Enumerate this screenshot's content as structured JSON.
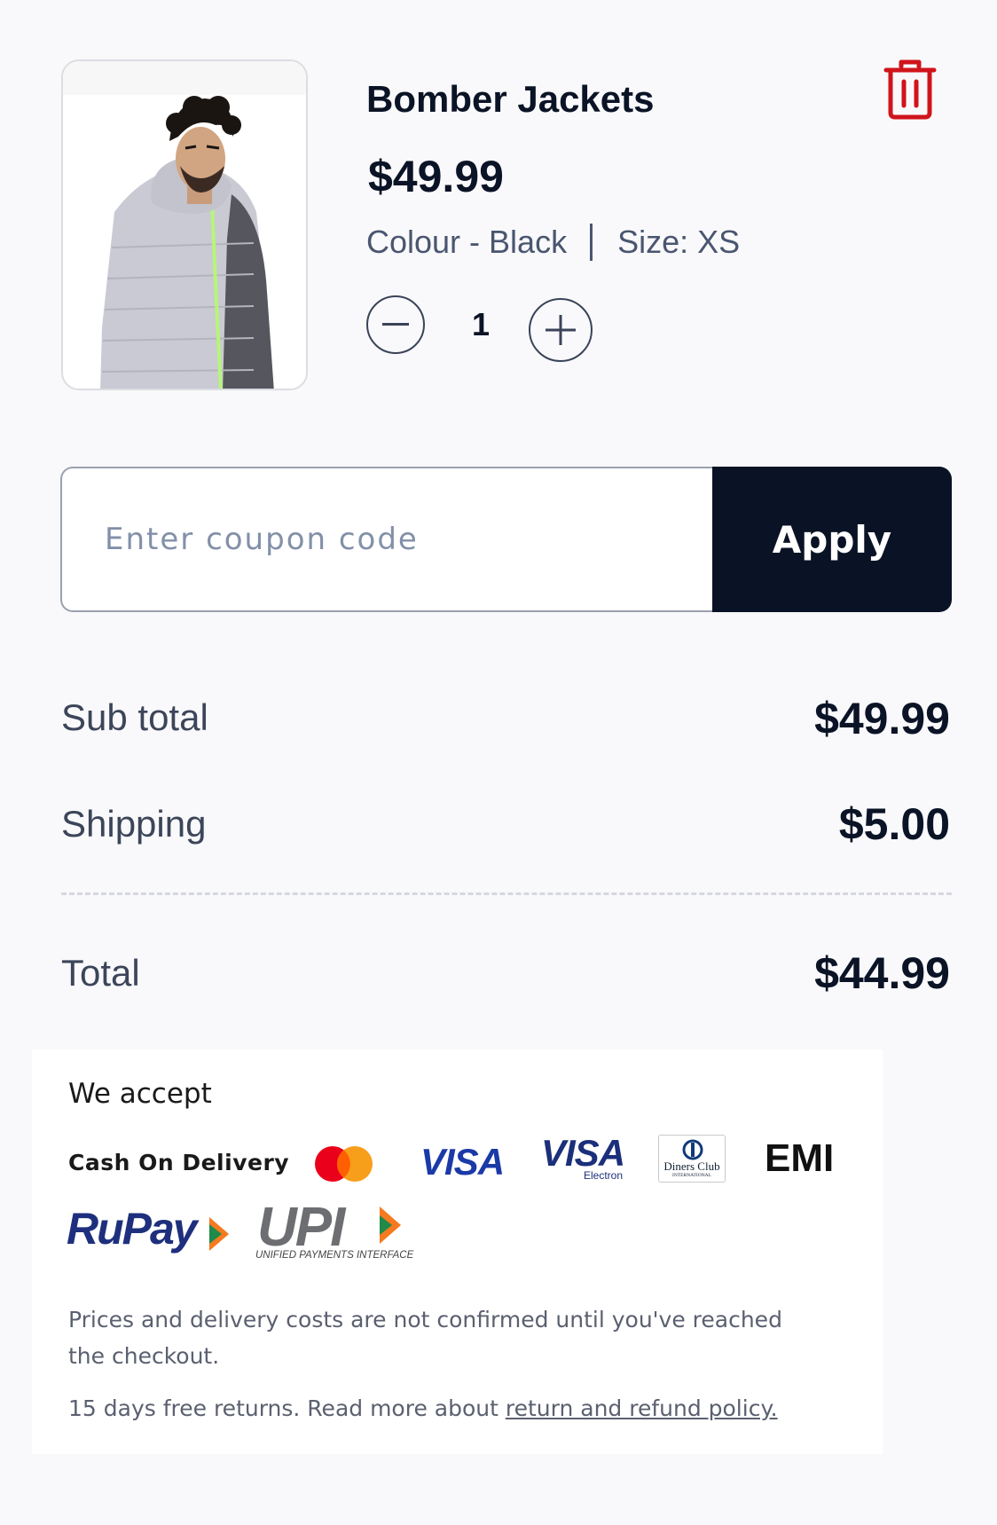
{
  "product": {
    "title": "Bomber Jackets",
    "price": "$49.99",
    "colour": "Colour - Black",
    "size": "Size: XS",
    "quantity": "1",
    "icons": {
      "delete": "trash-icon",
      "decrease": "minus-circle-icon",
      "increase": "plus-circle-icon"
    },
    "accent_color": "#d0141b"
  },
  "coupon": {
    "placeholder": "Enter coupon code",
    "value": "",
    "apply_label": "Apply"
  },
  "summary": {
    "subtotal_label": "Sub total",
    "subtotal_value": "$49.99",
    "shipping_label": "Shipping",
    "shipping_value": "$5.00",
    "total_label": "Total",
    "total_value": "$44.99"
  },
  "payments": {
    "title": "We accept",
    "cod": "Cash On Delivery",
    "visa": "VISA",
    "visa_electron": "VISA",
    "visa_electron_sub": "Electron",
    "diners": "Diners Club",
    "diners_sub": "INTERNATIONAL",
    "emi": "EMI",
    "rupay": "RuPay",
    "upi": "UPI",
    "upi_sub": "UNIFIED PAYMENTS INTERFACE"
  },
  "notes": {
    "prices_note": "Prices and delivery costs are not confirmed until you've reached the checkout.",
    "returns_note": "15 days free returns. Read more about ",
    "returns_link": "return and refund policy."
  }
}
